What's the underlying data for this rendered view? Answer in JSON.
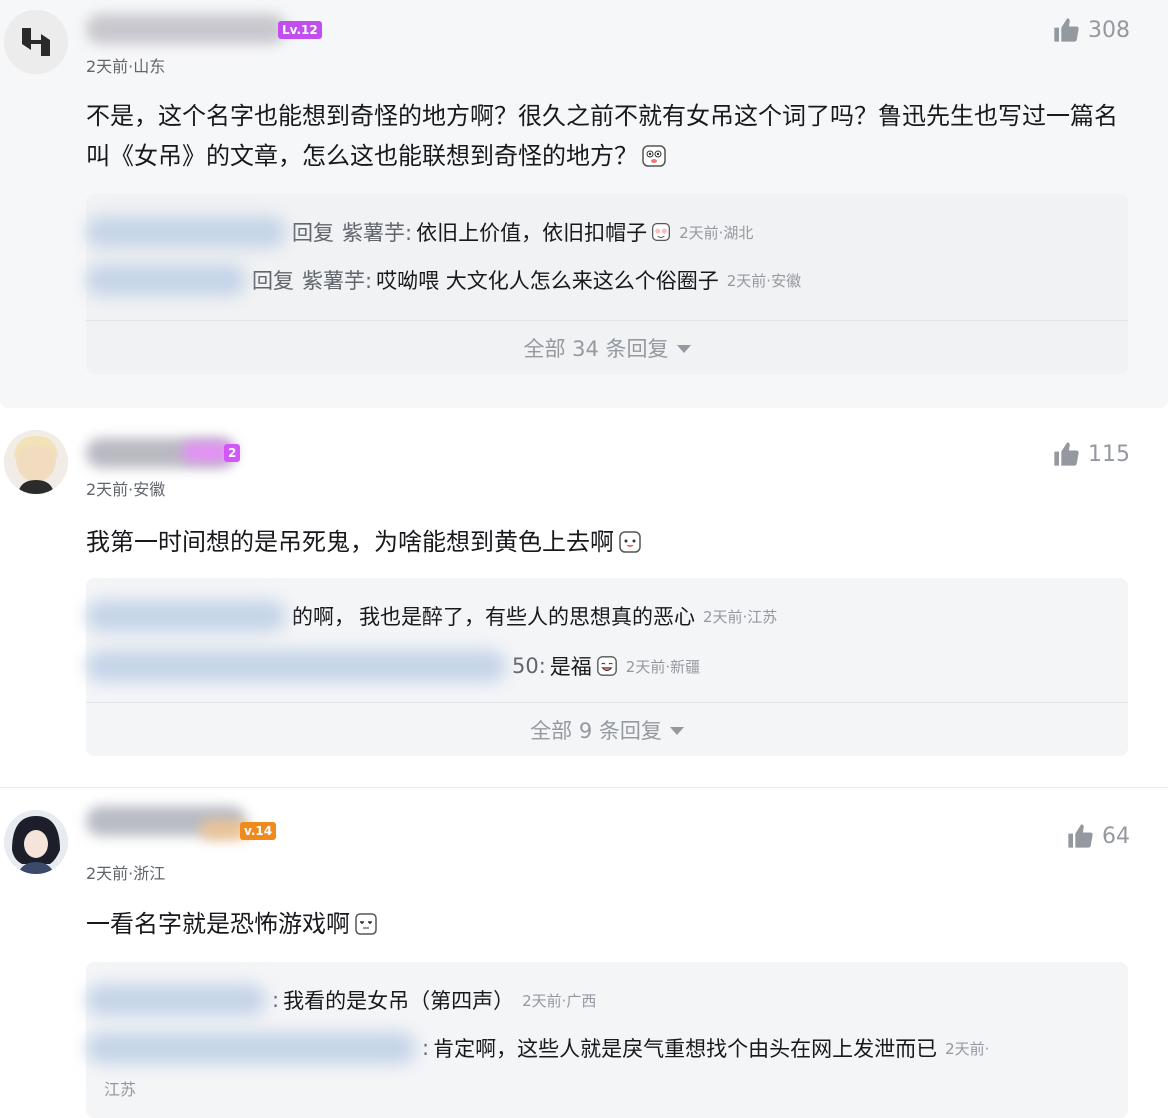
{
  "comments": [
    {
      "level": "Lv.12",
      "meta": "2天前·山东",
      "likes": "308",
      "content": "不是，这个名字也能想到奇怪的地方啊？很久之前不就有女吊这个词了吗？鲁迅先生也写过一篇名叫《女吊》的文章，怎么这也能联想到奇怪的地方？",
      "replies": [
        {
          "prefix": "回复",
          "ref": "紫薯芋:",
          "text": "依旧上价值，依旧扣帽子",
          "time": "2天前·湖北"
        },
        {
          "prefix": "回复",
          "ref": "紫薯芋:",
          "text": "哎呦喂 大文化人怎么来这么个俗圈子",
          "time": "2天前·安徽"
        }
      ],
      "more": "全部 34 条回复"
    },
    {
      "level": "2",
      "meta": "2天前·安徽",
      "likes": "115",
      "content": "我第一时间想的是吊死鬼，为啥能想到黄色上去啊",
      "replies": [
        {
          "prefix": "",
          "ref": "的啊，",
          "text": "我也是醉了，有些人的思想真的恶心",
          "time": "2天前·江苏"
        },
        {
          "prefix": "",
          "ref": "50:",
          "text": "是福",
          "time": "2天前·新疆"
        }
      ],
      "more": "全部 9 条回复"
    },
    {
      "level": "v.14",
      "meta": "2天前·浙江",
      "likes": "64",
      "content": "一看名字就是恐怖游戏啊",
      "replies": [
        {
          "prefix": "",
          "ref": ":",
          "text": "我看的是女吊（第四声）",
          "time": "2天前·广西"
        },
        {
          "prefix": "",
          "ref": ":",
          "text": "肯定啊，这些人就是戾气重想找个由头在网上发泄而已",
          "time": "2天前·",
          "tail": "江苏"
        }
      ]
    }
  ],
  "colors": {
    "accent": "#00aeec",
    "text": "#18191c",
    "muted": "#9499a0",
    "lv12": "#c34ef0",
    "lv14": "#f08a1c"
  },
  "icons": [
    "thumb-up-icon",
    "emoji-icon",
    "caret-down-icon"
  ]
}
